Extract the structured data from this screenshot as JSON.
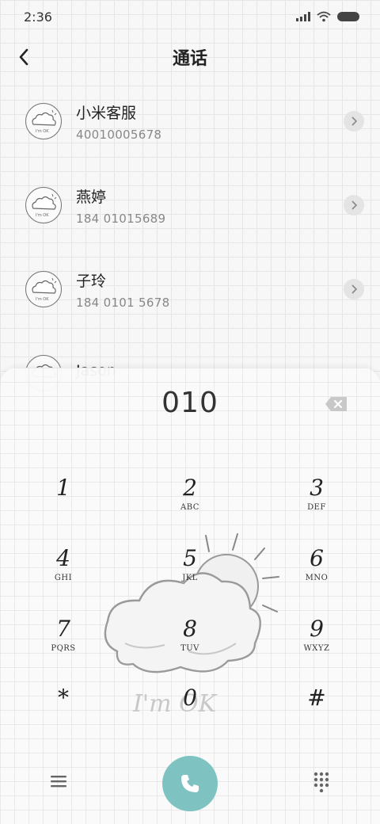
{
  "status_bar": {
    "time": "2:36",
    "icons": [
      "signal-icon",
      "wifi-icon",
      "battery-icon"
    ]
  },
  "header": {
    "title": "通话",
    "back_icon": "back-arrow-icon"
  },
  "contacts": [
    {
      "name": "小米客服",
      "number": "40010005678"
    },
    {
      "name": "燕婷",
      "number": "184 01015689"
    },
    {
      "name": "子玲",
      "number": "184 0101 5678"
    },
    {
      "name": "Jason",
      "number": ""
    }
  ],
  "dialpad": {
    "entered_number": "010",
    "backspace_icon": "backspace-icon",
    "keys": [
      {
        "digit": "1",
        "letters": ""
      },
      {
        "digit": "2",
        "letters": "ABC"
      },
      {
        "digit": "3",
        "letters": "DEF"
      },
      {
        "digit": "4",
        "letters": "GHI"
      },
      {
        "digit": "5",
        "letters": "JKL"
      },
      {
        "digit": "6",
        "letters": "MNO"
      },
      {
        "digit": "7",
        "letters": "PQRS"
      },
      {
        "digit": "8",
        "letters": "TUV"
      },
      {
        "digit": "9",
        "letters": "WXYZ"
      },
      {
        "digit": "*",
        "letters": ""
      },
      {
        "digit": "0",
        "letters": ""
      },
      {
        "digit": "#",
        "letters": ""
      }
    ],
    "watermark_text": "I'm OK",
    "bottom": {
      "menu_icon": "menu-icon",
      "call_icon": "phone-icon",
      "keypad_icon": "keypad-icon"
    }
  },
  "colors": {
    "call_button": "#7fc2c2",
    "background": "#f7f7f7",
    "grid_line": "#e6e6e6"
  }
}
